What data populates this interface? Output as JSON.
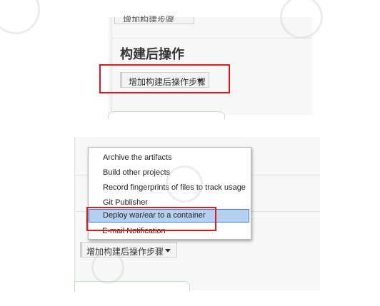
{
  "top_panel": {
    "cut_button_label": "增加构建步骤",
    "section_title": "构建后操作",
    "post_build_button_label": "增加构建后操作步骤"
  },
  "bottom_panel": {
    "post_build_button_label": "增加构建后操作步骤"
  },
  "menu": {
    "items": [
      {
        "label": "Archive the artifacts"
      },
      {
        "label": "Build other projects"
      },
      {
        "label": "Record fingerprints of files to track usage"
      },
      {
        "label": "Git Publisher"
      },
      {
        "label": "Deploy war/ear to a container"
      },
      {
        "label": "E-mail Notification"
      }
    ],
    "highlighted_index": 4
  },
  "colors": {
    "highlight_box": "#e1191b",
    "menu_selection": "#b6d0f1"
  }
}
